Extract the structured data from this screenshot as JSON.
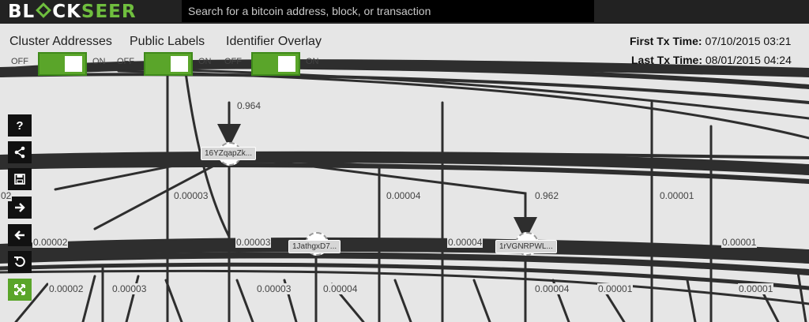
{
  "logo": {
    "part1": "BL",
    "part2": "CK",
    "part3": "SEER"
  },
  "search": {
    "placeholder": "Search for a bitcoin address, block, or transaction"
  },
  "controls": {
    "cluster_label": "Cluster Addresses",
    "labels_label": "Public Labels",
    "identifier_label": "Identifier Overlay",
    "off": "OFF",
    "on": "ON"
  },
  "txinfo": {
    "first_label": "First Tx Time:",
    "first_value": "07/10/2015 03:21",
    "last_label": "Last Tx Time:",
    "last_value": "08/01/2015 04:24"
  },
  "sidebar": {
    "help": "?",
    "share": "share-icon",
    "save": "save-icon",
    "forward": "arrow-right-icon",
    "back": "arrow-left-icon",
    "reset": "reset-icon",
    "fullscreen": "expand-icon"
  },
  "nodes": {
    "n1": "16YZqapZk...",
    "n2": "1JathgxD7...",
    "n3": "1rVGNRPWL..."
  },
  "edges": {
    "e1": "0.964",
    "e2": "0.00003",
    "e3": "0.00004",
    "e4": "0.962",
    "e5": "0.00001",
    "e6": "0.00002",
    "e7": "0.00003",
    "e8": "0.00004",
    "e9": "0.00001",
    "e10": "0.00002",
    "e11": "0.00003",
    "e12": "0.00003",
    "e13": "0.00004",
    "e14": "0.00004",
    "e15": "0.00001",
    "e16": "0.00001",
    "e17": "02"
  },
  "colors": {
    "accent": "#5aa52a",
    "bar": "#222222",
    "edge": "#2e2e2e"
  }
}
